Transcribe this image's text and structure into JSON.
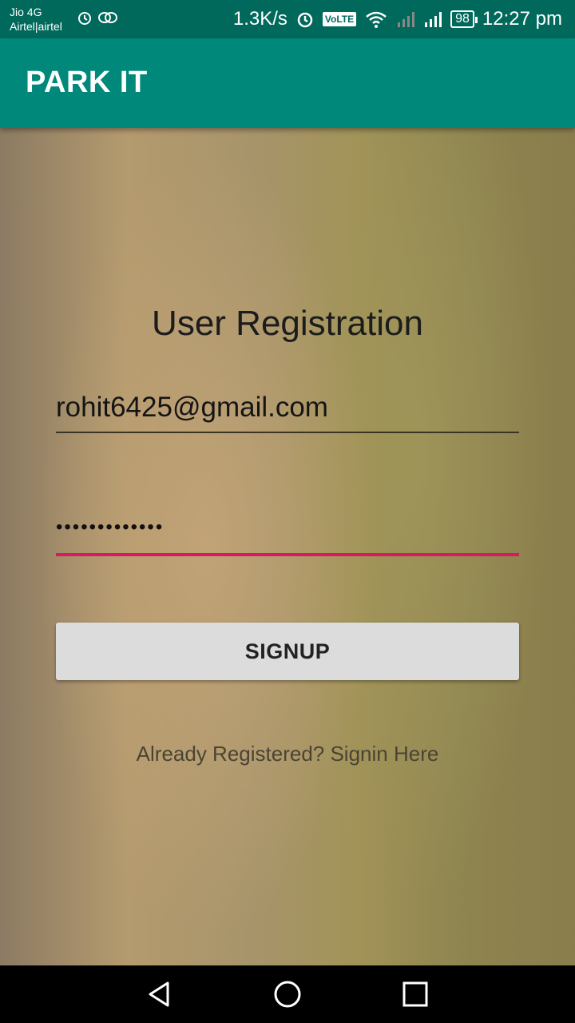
{
  "status_bar": {
    "carrier_1": "Jio 4G",
    "carrier_2": "Airtel|airtel",
    "net_speed": "1.3K/s",
    "volte": "VoLTE",
    "battery": "98",
    "time": "12:27 pm",
    "icons": [
      "alarm-icon",
      "sync-icon",
      "alarm-icon",
      "volte-icon",
      "wifi-icon",
      "signal-icon",
      "signal-icon",
      "battery-icon"
    ]
  },
  "app_bar": {
    "title": "PARK IT"
  },
  "form": {
    "title": "User Registration",
    "email_value": "rohit6425@gmail.com",
    "password_mask": "•••••••••••••",
    "signup_label": "SIGNUP",
    "signin_link": "Already Registered? Signin Here"
  },
  "nav_bar": {
    "icons": [
      "back-icon",
      "home-icon",
      "recents-icon"
    ]
  },
  "colors": {
    "status_bar": "#00695c",
    "app_bar": "#00897b",
    "accent": "#d81b60",
    "button": "#dcdcdc"
  }
}
